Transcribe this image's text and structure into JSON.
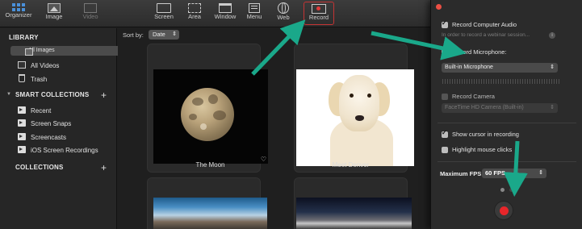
{
  "toolbar": {
    "organizer": "Organizer",
    "image": "Image",
    "video": "Video",
    "screen": "Screen",
    "area": "Area",
    "window": "Window",
    "menu": "Menu",
    "web": "Web",
    "record": "Record"
  },
  "sidebar": {
    "library_header": "LIBRARY",
    "library_items": [
      {
        "label": "All Images",
        "icon": "image-icon",
        "selected": true
      },
      {
        "label": "All Videos",
        "icon": "video-icon"
      },
      {
        "label": "Trash",
        "icon": "trash-icon"
      }
    ],
    "smart_header": "SMART COLLECTIONS",
    "smart_items": [
      {
        "label": "Recent",
        "icon": "smart-folder-icon"
      },
      {
        "label": "Screen Snaps",
        "icon": "smart-folder-icon"
      },
      {
        "label": "Screencasts",
        "icon": "smart-folder-icon"
      },
      {
        "label": "iOS Screen Recordings",
        "icon": "smart-folder-icon"
      }
    ],
    "collections_header": "COLLECTIONS",
    "plus": "+"
  },
  "content": {
    "sort_label": "Sort by:",
    "sort_value": "Date",
    "items": [
      {
        "caption": "The Moon"
      },
      {
        "caption": "Meet Denver"
      }
    ]
  },
  "panel": {
    "record_audio": "Record Computer Audio",
    "audio_hint": "In order to record a webinar session...",
    "record_mic": "Record Microphone:",
    "mic_device": "Built-in Microphone",
    "record_camera": "Record Camera",
    "camera_device": "FaceTime HD Camera (Built-in)",
    "show_cursor": "Show cursor in recording",
    "highlight_clicks": "Highlight mouse clicks",
    "fps_label": "Maximum FPS:",
    "fps_value": "60 FPS",
    "checked": {
      "audio": true,
      "mic": false,
      "camera": false,
      "cursor": true,
      "highlight": false
    }
  },
  "colors": {
    "accent_arrow": "#1aa88a",
    "record_red": "#e8262a",
    "selection": "#4b4b4b"
  }
}
